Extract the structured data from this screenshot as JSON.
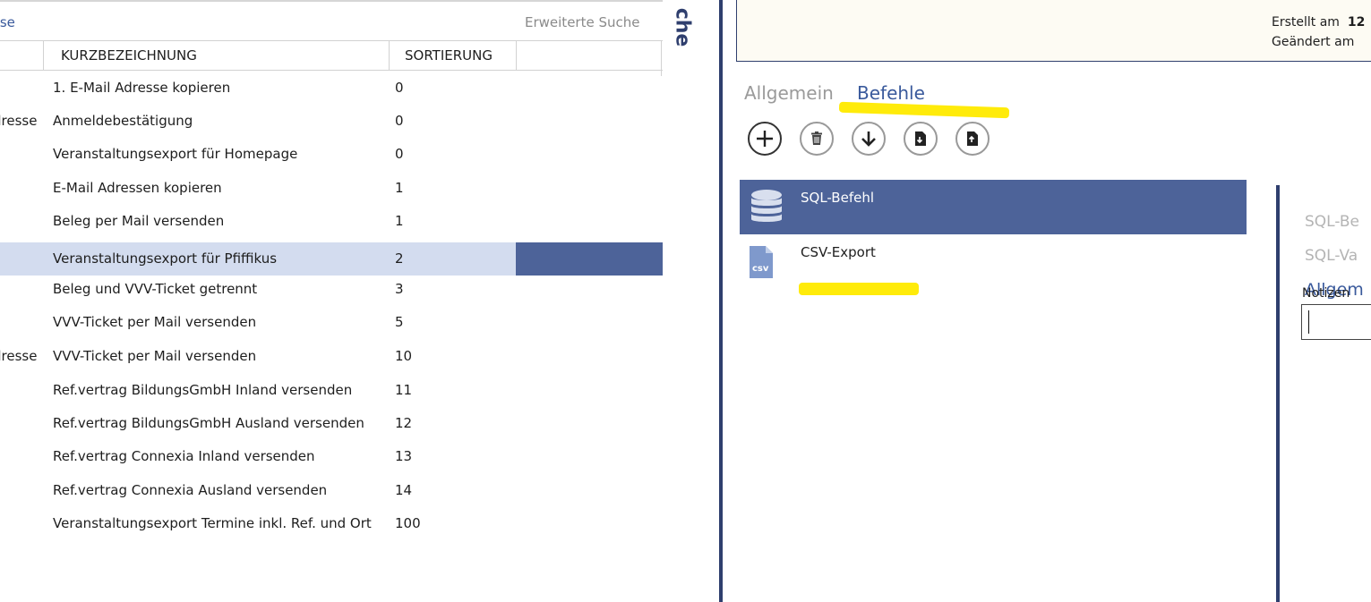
{
  "left": {
    "top_link": "sse",
    "advanced_search": "Erweiterte Suche",
    "columns": [
      "KURZBEZEICHNUNG",
      "SORTIERUNG"
    ],
    "rows": [
      {
        "a": "",
        "name": "1. E-Mail Adresse kopieren",
        "sort": "0"
      },
      {
        "a": "dresse",
        "name": "Anmeldebestätigung",
        "sort": "0"
      },
      {
        "a": "",
        "name": "Veranstaltungsexport für Homepage",
        "sort": "0"
      },
      {
        "a": "",
        "name": "E-Mail Adressen kopieren",
        "sort": "1"
      },
      {
        "a": "",
        "name": "Beleg per Mail versenden",
        "sort": "1"
      },
      {
        "a": "",
        "name": "Veranstaltungsexport für Pfiffikus",
        "sort": "2"
      },
      {
        "a": "",
        "name": "Beleg und VVV-Ticket getrennt",
        "sort": "3"
      },
      {
        "a": "",
        "name": "VVV-Ticket per Mail versenden",
        "sort": "5"
      },
      {
        "a": "dresse",
        "name": "VVV-Ticket per Mail versenden",
        "sort": "10"
      },
      {
        "a": "",
        "name": "Ref.vertrag BildungsGmbH Inland versenden",
        "sort": "11"
      },
      {
        "a": "",
        "name": "Ref.vertrag BildungsGmbH Ausland versenden",
        "sort": "12"
      },
      {
        "a": "",
        "name": "Ref.vertrag Connexia Inland versenden",
        "sort": "13"
      },
      {
        "a": "",
        "name": "Ref.vertrag Connexia Ausland versenden",
        "sort": "14"
      },
      {
        "a": "",
        "name": "Veranstaltungsexport Termine inkl. Ref. und Ort",
        "sort": "100"
      }
    ]
  },
  "vertical_title": "che",
  "info": {
    "created_label": "Erstellt am",
    "created_value": "12",
    "changed_label": "Geändert am"
  },
  "tabs": {
    "allgemein": "Allgemein",
    "befehle": "Befehle"
  },
  "toolbar": {
    "add": "add-icon",
    "delete": "trash-icon",
    "down": "arrow-down-icon",
    "import": "file-import-icon",
    "export": "file-export-icon"
  },
  "commands": [
    {
      "label": "SQL-Befehl",
      "icon": "database-icon"
    },
    {
      "label": "CSV-Export",
      "icon": "csv-file-icon",
      "icon_text": "csv"
    }
  ],
  "properties": {
    "sql_be": "SQL-Be",
    "sql_va": "SQL-Va",
    "allgem": "Allgem",
    "notizen": "Notizen"
  },
  "colors": {
    "accent": "#4d6399",
    "selected_light": "#d3dcef",
    "dark_navy": "#2f3f6e",
    "highlight": "#ffeb0a",
    "link": "#3a5a9c"
  }
}
